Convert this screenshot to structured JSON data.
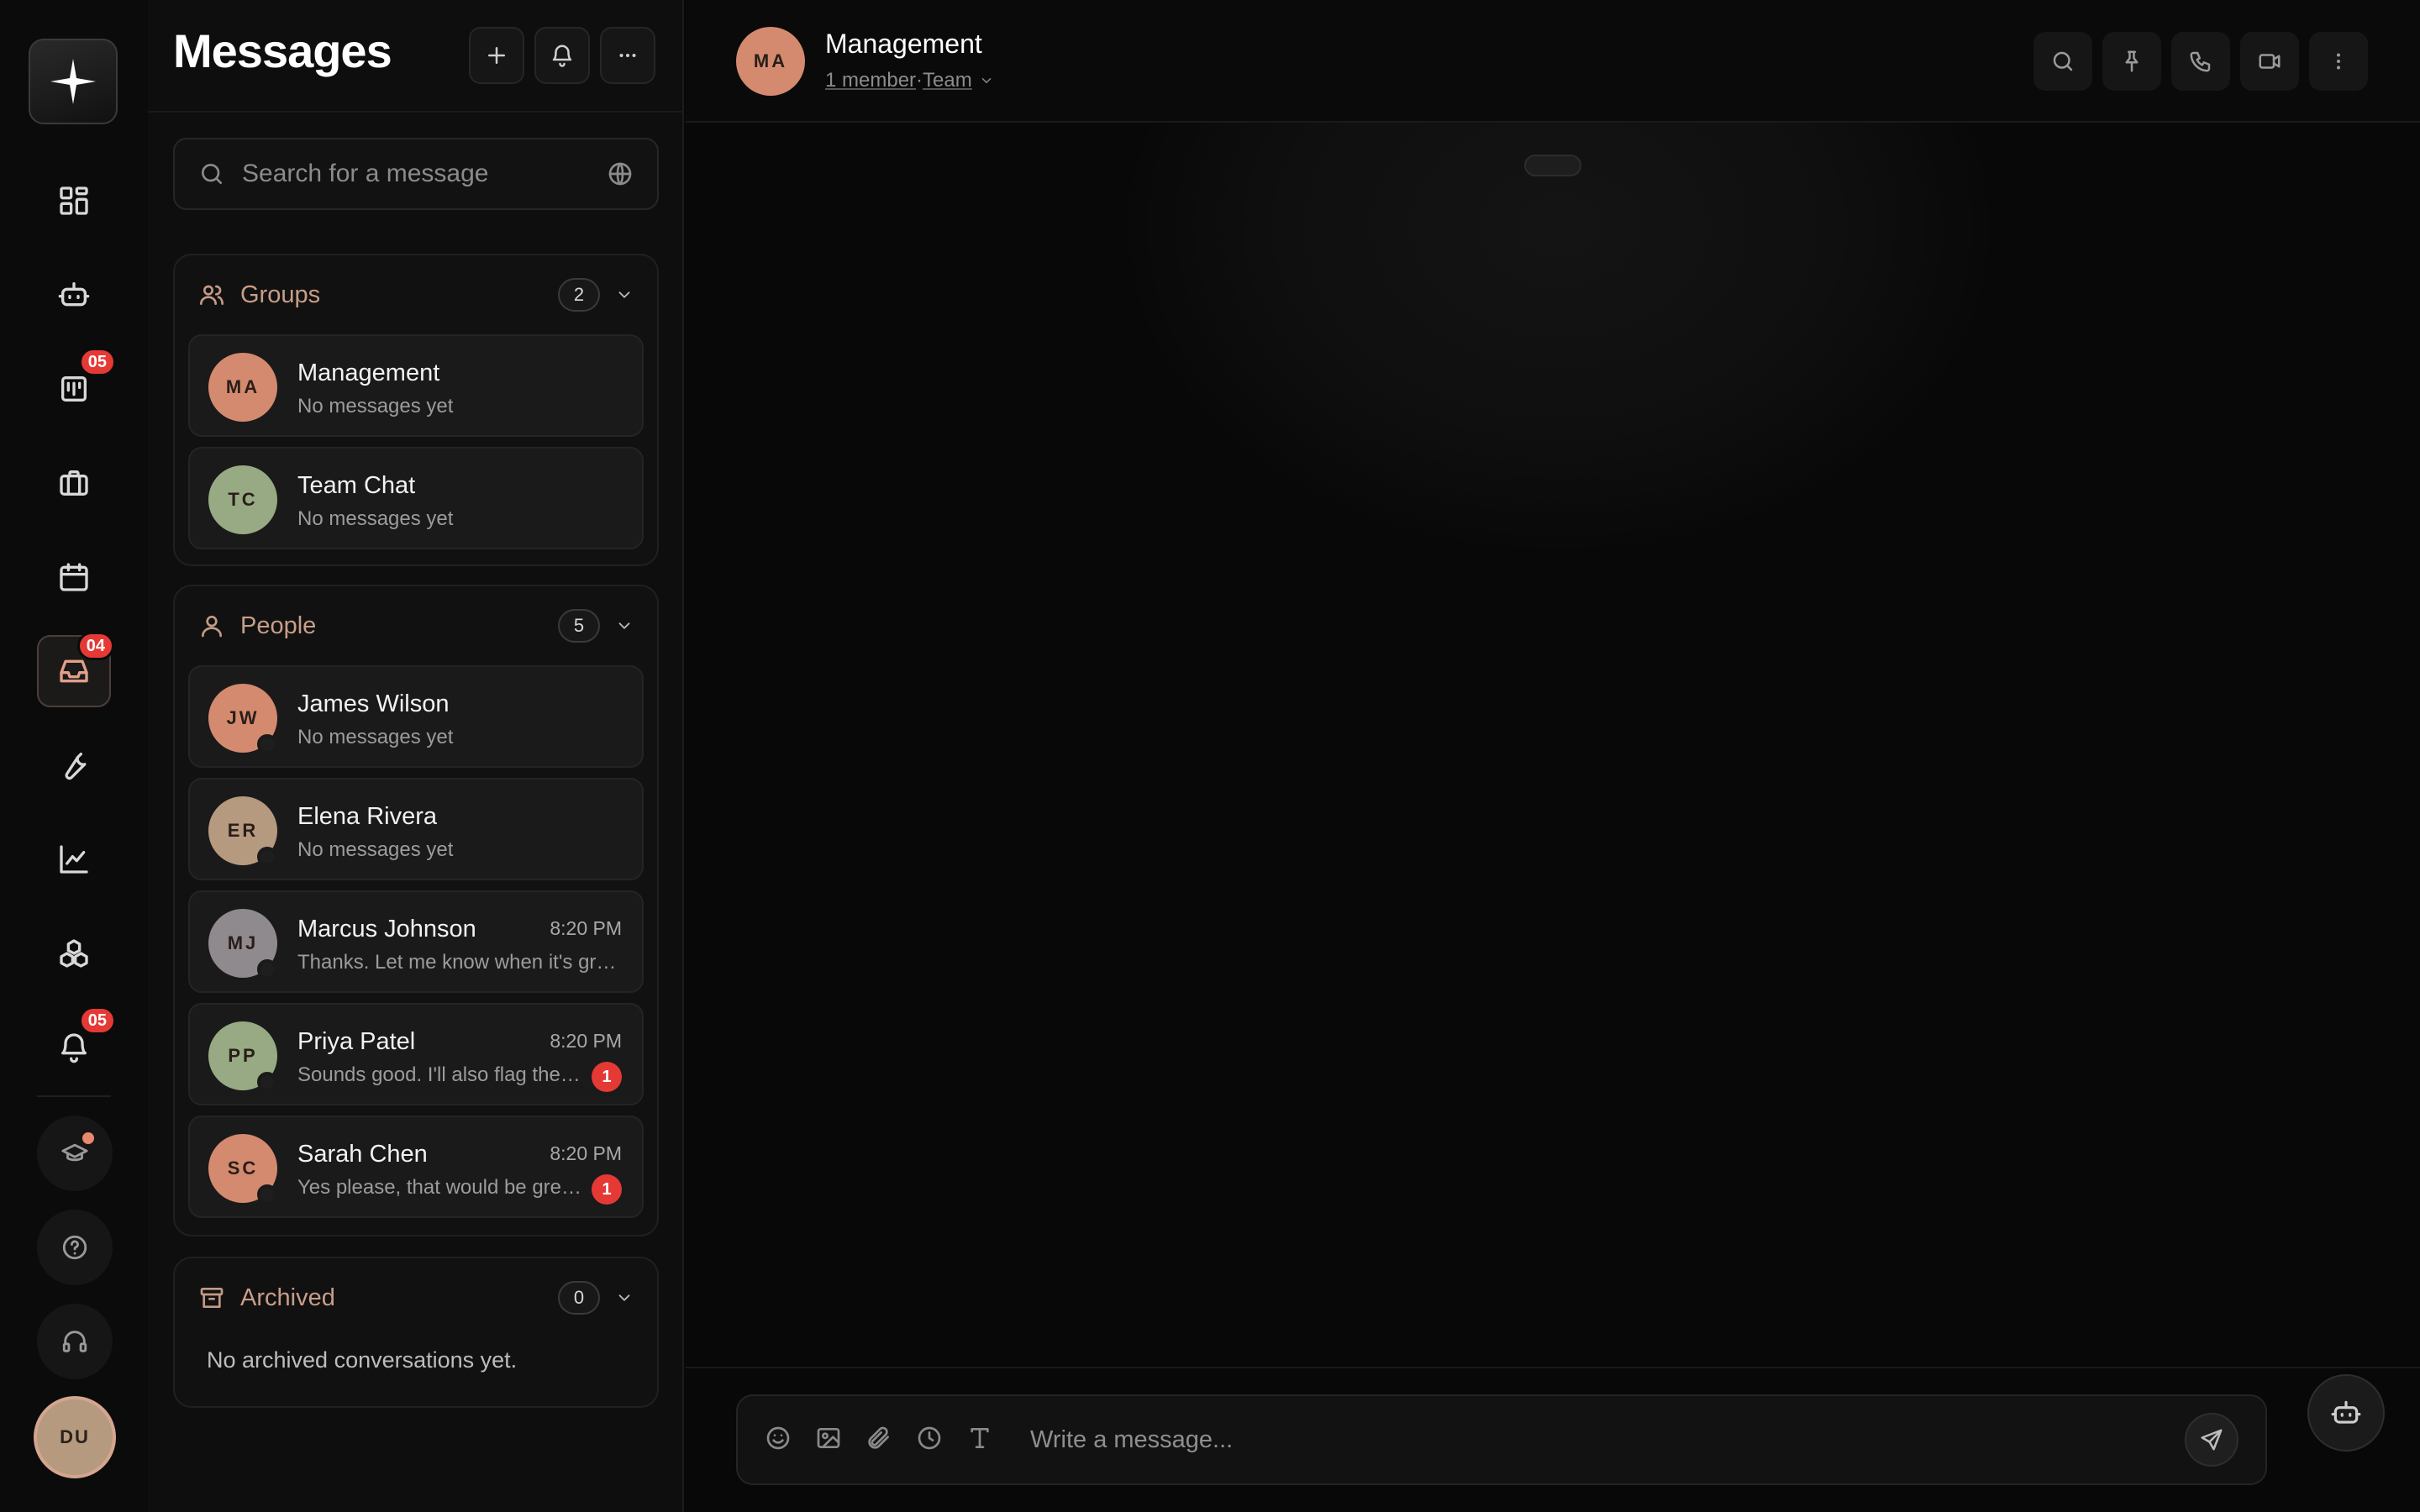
{
  "rail": {
    "badges": {
      "tasks": "05",
      "inbox": "04",
      "notifications": "05"
    },
    "user_initials": "DU"
  },
  "messages": {
    "title": "Messages",
    "search_placeholder": "Search for a message",
    "groups": {
      "title": "Groups",
      "count": "2",
      "items": [
        {
          "initials": "MA",
          "name": "Management",
          "preview": "No messages yet",
          "color": "#d48a6f"
        },
        {
          "initials": "TC",
          "name": "Team Chat",
          "preview": "No messages yet",
          "color": "#97aa84"
        }
      ]
    },
    "people": {
      "title": "People",
      "count": "5",
      "items": [
        {
          "initials": "JW",
          "name": "James Wilson",
          "preview": "No messages yet",
          "time": "",
          "unread": "",
          "color": "#d48a6f"
        },
        {
          "initials": "ER",
          "name": "Elena Rivera",
          "preview": "No messages yet",
          "time": "",
          "unread": "",
          "color": "#b59a80"
        },
        {
          "initials": "MJ",
          "name": "Marcus Johnson",
          "preview": "Thanks. Let me know when it's green...",
          "time": "8:20 PM",
          "unread": "",
          "color": "#8e8a8d"
        },
        {
          "initials": "PP",
          "name": "Priya Patel",
          "preview": "Sounds good. I'll also flag the A...",
          "time": "8:20 PM",
          "unread": "1",
          "color": "#97aa84"
        },
        {
          "initials": "SC",
          "name": "Sarah Chen",
          "preview": "Yes please, that would be great.",
          "time": "8:20 PM",
          "unread": "1",
          "color": "#d48a6f"
        }
      ]
    },
    "archived": {
      "title": "Archived",
      "count": "0",
      "empty_text": "No archived conversations yet."
    }
  },
  "chat": {
    "initials": "MA",
    "title": "Management",
    "subtitle_members": "1 member",
    "subtitle_sep": " · ",
    "subtitle_type": "Team",
    "composer_placeholder": "Write a message..."
  }
}
